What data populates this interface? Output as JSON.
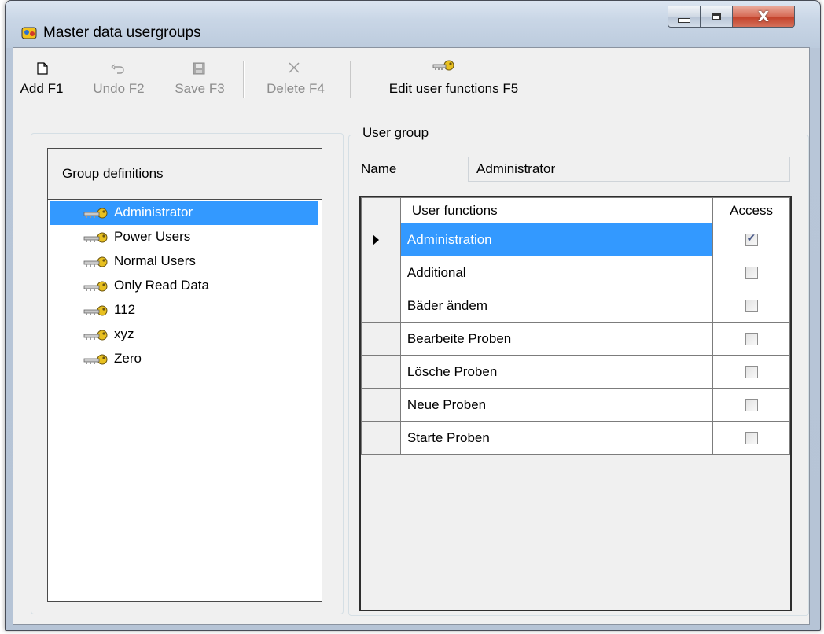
{
  "window": {
    "title": "Master data usergroups",
    "close_glyph": "X"
  },
  "toolbar": {
    "add": {
      "label": "Add F1",
      "icon": "new-document-icon",
      "enabled": true
    },
    "undo": {
      "label": "Undo F2",
      "icon": "undo-icon",
      "enabled": false
    },
    "save": {
      "label": "Save F3",
      "icon": "floppy-disk-icon",
      "enabled": false
    },
    "delete": {
      "label": "Delete F4",
      "icon": "delete-x-icon",
      "enabled": false
    },
    "edit": {
      "label": "Edit user functions F5",
      "icon": "key-icon",
      "enabled": true
    }
  },
  "left_panel": {
    "header": "Group definitions",
    "items": [
      {
        "label": "Administrator",
        "selected": true
      },
      {
        "label": "Power Users",
        "selected": false
      },
      {
        "label": "Normal Users",
        "selected": false
      },
      {
        "label": "Only Read Data",
        "selected": false
      },
      {
        "label": "112",
        "selected": false
      },
      {
        "label": "xyz",
        "selected": false
      },
      {
        "label": "Zero",
        "selected": false
      }
    ]
  },
  "user_group": {
    "legend": "User group",
    "name_label": "Name",
    "name_value": "Administrator"
  },
  "grid": {
    "col_functions": "User functions",
    "col_access": "Access",
    "rows": [
      {
        "function": "Administration",
        "access": true,
        "selected": true
      },
      {
        "function": "Additional",
        "access": false,
        "selected": false
      },
      {
        "function": "Bäder ändem",
        "access": false,
        "selected": false
      },
      {
        "function": "Bearbeite Proben",
        "access": false,
        "selected": false
      },
      {
        "function": "Lösche Proben",
        "access": false,
        "selected": false
      },
      {
        "function": "Neue Proben",
        "access": false,
        "selected": false
      },
      {
        "function": "Starte Proben",
        "access": false,
        "selected": false
      }
    ]
  },
  "colors": {
    "selection": "#3399ff",
    "disabled_text": "#8d8d8d"
  }
}
